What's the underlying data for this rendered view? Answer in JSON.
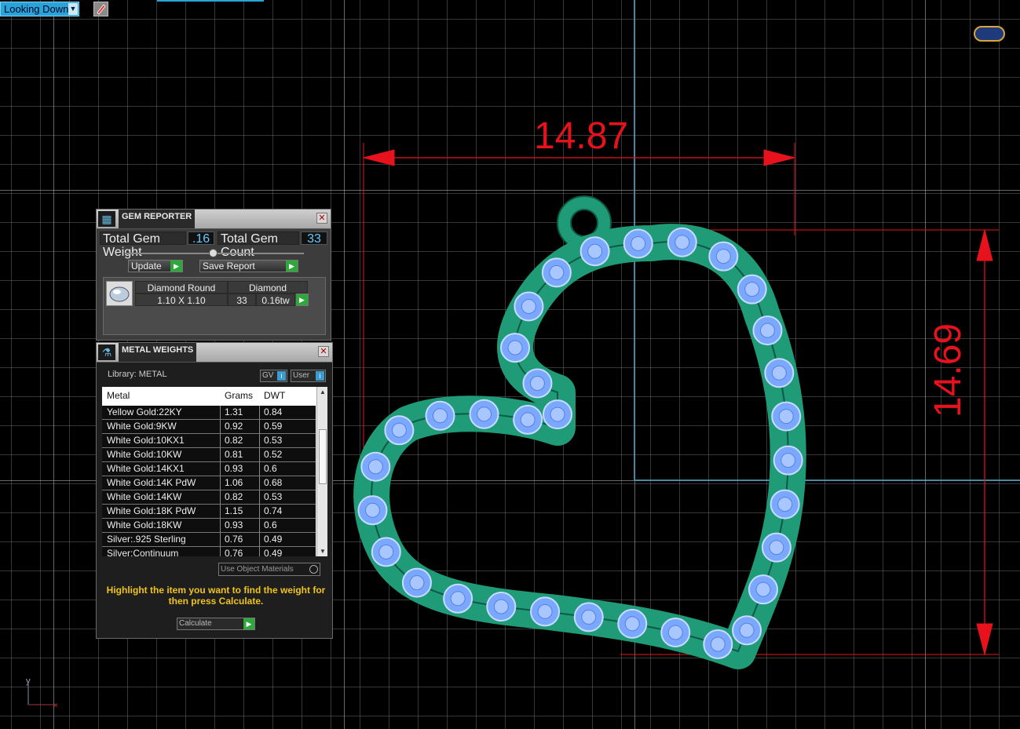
{
  "viewport": {
    "view_mode": "Looking Down",
    "dimension_width": "14.87",
    "dimension_height": "14.69",
    "axis_label": "y",
    "colors": {
      "background": "#000000",
      "dimension": "#e8121c",
      "metal": "#1f9b78",
      "gem": "#7aa8ff"
    }
  },
  "gem_reporter": {
    "title": "GEM REPORTER",
    "total_weight_label": "Total Gem Weight",
    "total_weight_value": ".16",
    "total_count_label": "Total Gem Count",
    "total_count_value": "33",
    "update_label": "Update",
    "save_report_label": "Save Report",
    "gem": {
      "shape": "Diamond Round",
      "material": "Diamond",
      "size": "1.10 X 1.10",
      "count": "33",
      "weight": "0.16tw"
    }
  },
  "metal_weights": {
    "title": "METAL WEIGHTS",
    "library_label": "Library: METAL",
    "gv_label": "GV",
    "user_label": "User",
    "columns": [
      "Metal",
      "Grams",
      "DWT"
    ],
    "rows": [
      {
        "metal": "Yellow Gold:22KY",
        "grams": "1.31",
        "dwt": "0.84"
      },
      {
        "metal": "White Gold:9KW",
        "grams": "0.92",
        "dwt": "0.59"
      },
      {
        "metal": "White Gold:10KX1",
        "grams": "0.82",
        "dwt": "0.53"
      },
      {
        "metal": "White Gold:10KW",
        "grams": "0.81",
        "dwt": "0.52"
      },
      {
        "metal": "White Gold:14KX1",
        "grams": "0.93",
        "dwt": "0.6"
      },
      {
        "metal": "White Gold:14K PdW",
        "grams": "1.06",
        "dwt": "0.68"
      },
      {
        "metal": "White Gold:14KW",
        "grams": "0.82",
        "dwt": "0.53"
      },
      {
        "metal": "White Gold:18K PdW",
        "grams": "1.15",
        "dwt": "0.74"
      },
      {
        "metal": "White Gold:18KW",
        "grams": "0.93",
        "dwt": "0.6"
      },
      {
        "metal": "Silver:.925 Sterling",
        "grams": "0.76",
        "dwt": "0.49"
      },
      {
        "metal": "Silver:Continuum",
        "grams": "0.76",
        "dwt": "0.49"
      }
    ],
    "use_object_materials_label": "Use Object Materials",
    "hint": "Highlight the item you want to find the weight for then press Calculate.",
    "calculate_label": "Calculate"
  }
}
